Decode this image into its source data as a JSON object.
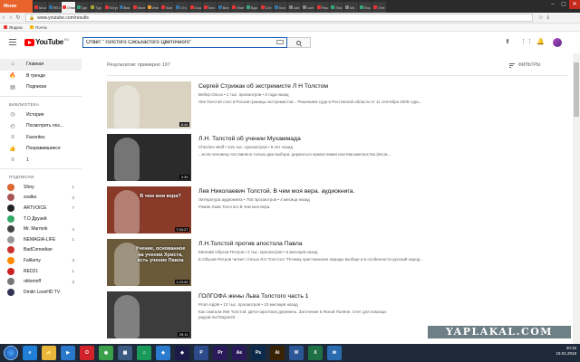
{
  "browser": {
    "menu_label": "Меню",
    "tabs": [
      {
        "label": "Мои",
        "color": "#e33"
      },
      {
        "label": "ЯПл",
        "color": "#37a"
      },
      {
        "label": "Ответ",
        "color": "#e33"
      },
      {
        "label": "Где",
        "color": "#3a7"
      },
      {
        "label": "Тур",
        "color": "#aa3"
      },
      {
        "label": "Ютуб",
        "color": "#e33"
      },
      {
        "label": "Взя",
        "color": "#37a"
      },
      {
        "label": "Мон",
        "color": "#e33"
      },
      {
        "label": "Ине",
        "color": "#e93"
      },
      {
        "label": "Кон",
        "color": "#e33"
      },
      {
        "label": "Сто",
        "color": "#37a"
      },
      {
        "label": "Сча",
        "color": "#e33"
      },
      {
        "label": "Бес",
        "color": "#e33"
      },
      {
        "label": "Все",
        "color": "#37a"
      },
      {
        "label": "Мон",
        "color": "#e33"
      },
      {
        "label": "Вдо",
        "color": "#3a7"
      },
      {
        "label": "Сот",
        "color": "#e33"
      },
      {
        "label": "Кон",
        "color": "#37a"
      },
      {
        "label": "cart",
        "color": "#888"
      },
      {
        "label": "cart",
        "color": "#888"
      },
      {
        "label": "Рыс",
        "color": "#e33"
      },
      {
        "label": "Пок",
        "color": "#3a7"
      },
      {
        "label": "shi",
        "color": "#888"
      },
      {
        "label": "Пок",
        "color": "#3a7"
      },
      {
        "label": "Отв",
        "color": "#e33"
      }
    ],
    "url": "www.youtube.com/results",
    "bookmarks": [
      {
        "label": "Яндекс",
        "color": "#e33"
      },
      {
        "label": "Почта",
        "color": "#f6b400"
      }
    ]
  },
  "header": {
    "logo_text": "YouTube",
    "region": "RU",
    "search_value": "Ответ \"Толстого Сисьхастого Цветочного\""
  },
  "sidebar": {
    "main_items": [
      {
        "label": "Главная",
        "icon": "⌂"
      },
      {
        "label": "В тренде",
        "icon": "🔥"
      },
      {
        "label": "Подписки",
        "icon": "▤"
      }
    ],
    "library_heading": "БИБЛИОТЕКА",
    "library_items": [
      {
        "label": "История",
        "icon": "◷"
      },
      {
        "label": "Посмотреть поз...",
        "icon": "◴"
      },
      {
        "label": "Favorites",
        "icon": "≡"
      },
      {
        "label": "Понравившиеся",
        "icon": "👍"
      },
      {
        "label": "1",
        "icon": "≡"
      }
    ],
    "subs_heading": "ПОДПИСКИ",
    "subscriptions": [
      {
        "label": "Sfory",
        "count": "1",
        "color": "#d63"
      },
      {
        "label": "svalka",
        "count": "2",
        "color": "#a55"
      },
      {
        "label": "ARTVOICE",
        "count": "7",
        "color": "#222"
      },
      {
        "label": "T.O Друзей",
        "count": "",
        "color": "#3a6"
      },
      {
        "label": "Mr. Marmok",
        "count": "4",
        "color": "#444"
      },
      {
        "label": "NEMAGIA-LIFE",
        "count": "1",
        "color": "#999"
      },
      {
        "label": "BadComedian",
        "count": "",
        "color": "#c33"
      },
      {
        "label": "Falilarny",
        "count": "3",
        "color": "#f80"
      },
      {
        "label": "RED21",
        "count": "1",
        "color": "#c22"
      },
      {
        "label": "oblomoff",
        "count": "2",
        "color": "#777"
      },
      {
        "label": "Dmitri LoveHD TV",
        "count": "",
        "color": "#335"
      }
    ]
  },
  "results": {
    "count_text": "Результатов: примерно 197",
    "filters_label": "ФИЛЬТРЫ",
    "videos": [
      {
        "title": "Сергей Стрижак об экстремисте Л Н Толстом",
        "meta": "Вебер Ольга • 1 тыс. просмотров • 3 года назад",
        "desc": "Лев Толстой стал в России границы экстремистов... Решением суда в Ростовской области от 11 сентября 2009 года...",
        "duration": "8:44",
        "thumb": "#d9d2c0"
      },
      {
        "title": "Л.Н. Толстой об учении Мухаммада",
        "meta": "Chechen Wolf • 215 тыс. просмотров • 8 лет назад",
        "desc": "...если человеку поставлено только два выбора: держаться православия или Магометанства (Исла...",
        "duration": "3:35",
        "thumb": "#2b2b2b"
      },
      {
        "title": "Лев Николаевич Толстой. В чем моя вера. аудиокнига.",
        "meta": "Литература аудиокнига • 750 просмотров • 4 месяца назад",
        "desc": "Роман Льва Толстого В чем моя вера.",
        "duration": "7:34:27",
        "thumb": "#8a3a28",
        "overlay": "В чем моя вера?"
      },
      {
        "title": "Л.Н.Толстой против апостола Павла",
        "meta": "Евгений Обухов-Петров • 2 тыс. просмотров • 5 месяцев назад",
        "desc": "Е.Обухов-Петров читает статью Л.Н.Толстого \"Почему христианские народы вообще и в особенности русский народ...",
        "duration": "1:23:26",
        "thumb": "#6b5a3a",
        "overlay": "Учение, основанное на учении Христа, есть учение Павла"
      },
      {
        "title": "ГОЛГОФА жены Льва Толстого часть 1",
        "meta": "Prom Apple • 13 тыс. просмотров • 10 месяцев назад",
        "desc": "Как сжигали Лев Толстой. Дети-сиротских деревень. Заточение в Ясной Поляне. Счет для помощи: paypal.me/Tatyan20.",
        "duration": "29:11",
        "thumb": "#3c3c3c"
      }
    ]
  },
  "watermark": "YAPLAKAL.COM",
  "taskbar": {
    "apps": [
      {
        "label": "e",
        "color": "#1f7fd6"
      },
      {
        "label": "📁",
        "color": "#e9b63c"
      },
      {
        "label": "▶",
        "color": "#2a78c9"
      },
      {
        "label": "O",
        "color": "#d2232a"
      },
      {
        "label": "◉",
        "color": "#3aa04a"
      },
      {
        "label": "▦",
        "color": "#3d5a80"
      },
      {
        "label": "♫",
        "color": "#1a9a5a"
      },
      {
        "label": "◈",
        "color": "#2b7bd0"
      },
      {
        "label": "◆",
        "color": "#1c1c4a"
      },
      {
        "label": "P",
        "color": "#2d4a8a"
      },
      {
        "label": "Pr",
        "color": "#2a1a5a"
      },
      {
        "label": "Ae",
        "color": "#2a1a5a"
      },
      {
        "label": "Ps",
        "color": "#0e2a4a"
      },
      {
        "label": "Ai",
        "color": "#3a2205"
      },
      {
        "label": "W",
        "color": "#2b5797"
      },
      {
        "label": "X",
        "color": "#1e7145"
      },
      {
        "label": "✉",
        "color": "#2b6cb0"
      }
    ],
    "time": "20:15",
    "date": "15.01.2018"
  }
}
